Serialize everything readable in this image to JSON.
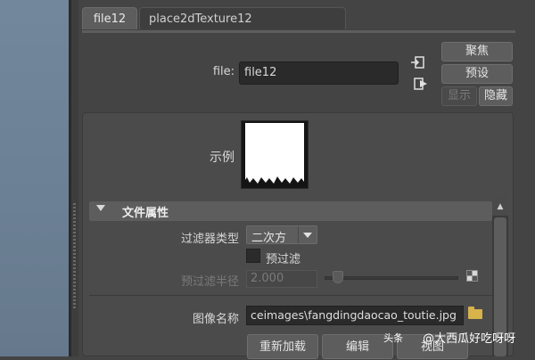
{
  "tabs": [
    {
      "label": "file12",
      "active": true
    },
    {
      "label": "place2dTexture12",
      "active": false
    }
  ],
  "file_field": {
    "label": "file:",
    "value": "file12"
  },
  "side_buttons": {
    "focus": "聚焦",
    "presets": "预设",
    "show": "显示",
    "hide": "隐藏"
  },
  "sample": {
    "label": "示例"
  },
  "attributes": {
    "title": "文件属性",
    "filter_type_label": "过滤器类型",
    "filter_type_value": "二次方",
    "prefilter_label": "预过滤",
    "prefilter_radius_label": "预过滤半径",
    "prefilter_radius_value": "2.000",
    "image_name_label": "图像名称",
    "image_name_value": "ceimages\\fangdingdaocao_toutie.jpg",
    "reload_button": "重新加载",
    "edit_button": "编辑",
    "view_button": "视图"
  },
  "watermark": {
    "logo": "头条",
    "text": "@大西瓜好吃呀呀"
  },
  "colors": {
    "panel_bg": "#444444",
    "tab_active": "#5d5d5d",
    "input_bg": "#2a2a2a",
    "viewport": "#6c8095"
  }
}
